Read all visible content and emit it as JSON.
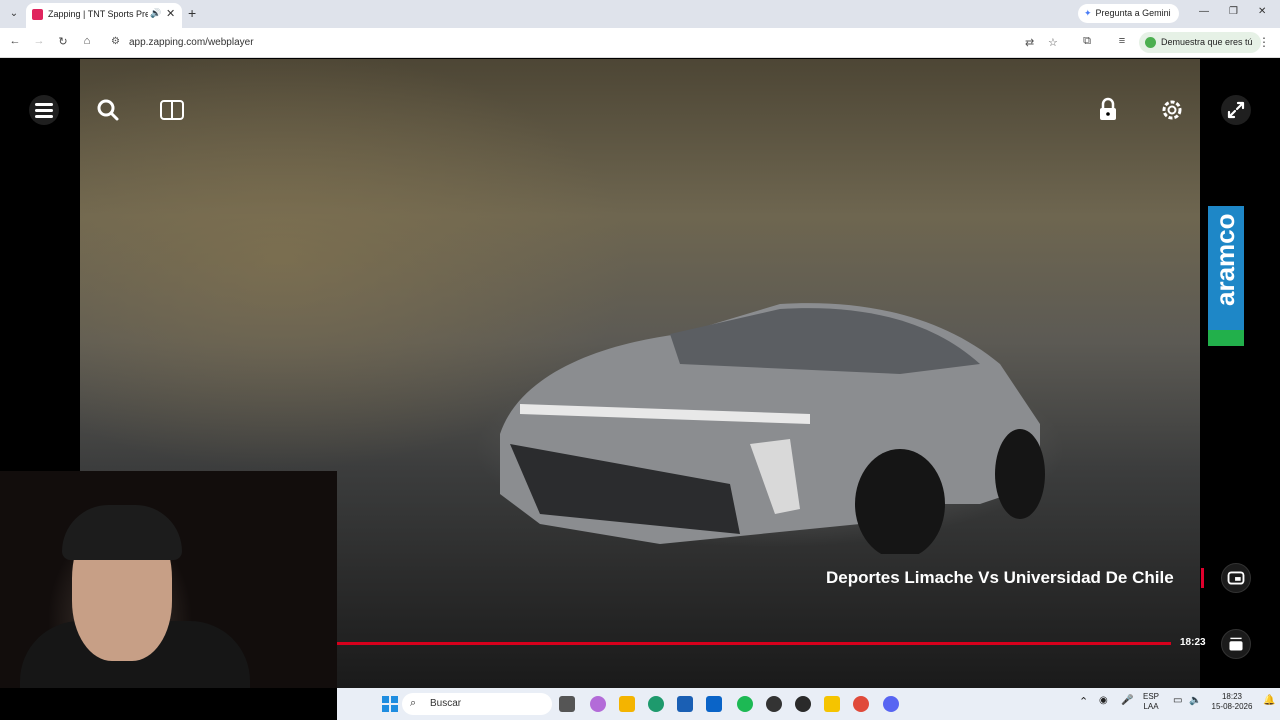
{
  "browser": {
    "tab_title": "Zapping | TNT Sports Premium",
    "new_tab": "+",
    "gemini_label": "Pregunta a Gemini",
    "url": "app.zapping.com/webplayer",
    "captcha_label": "Demuestra que eres tú"
  },
  "player": {
    "sponsor_text": "aramco",
    "match_title": "Deportes Limache Vs Universidad De Chile",
    "time": "18:23",
    "progress": 1.0,
    "accent_color": "#d6001c"
  },
  "taskbar": {
    "search_placeholder": "Buscar",
    "language": "ESP",
    "region": "LAA",
    "clock_time": "18:23",
    "clock_date": "15-08-2026"
  }
}
